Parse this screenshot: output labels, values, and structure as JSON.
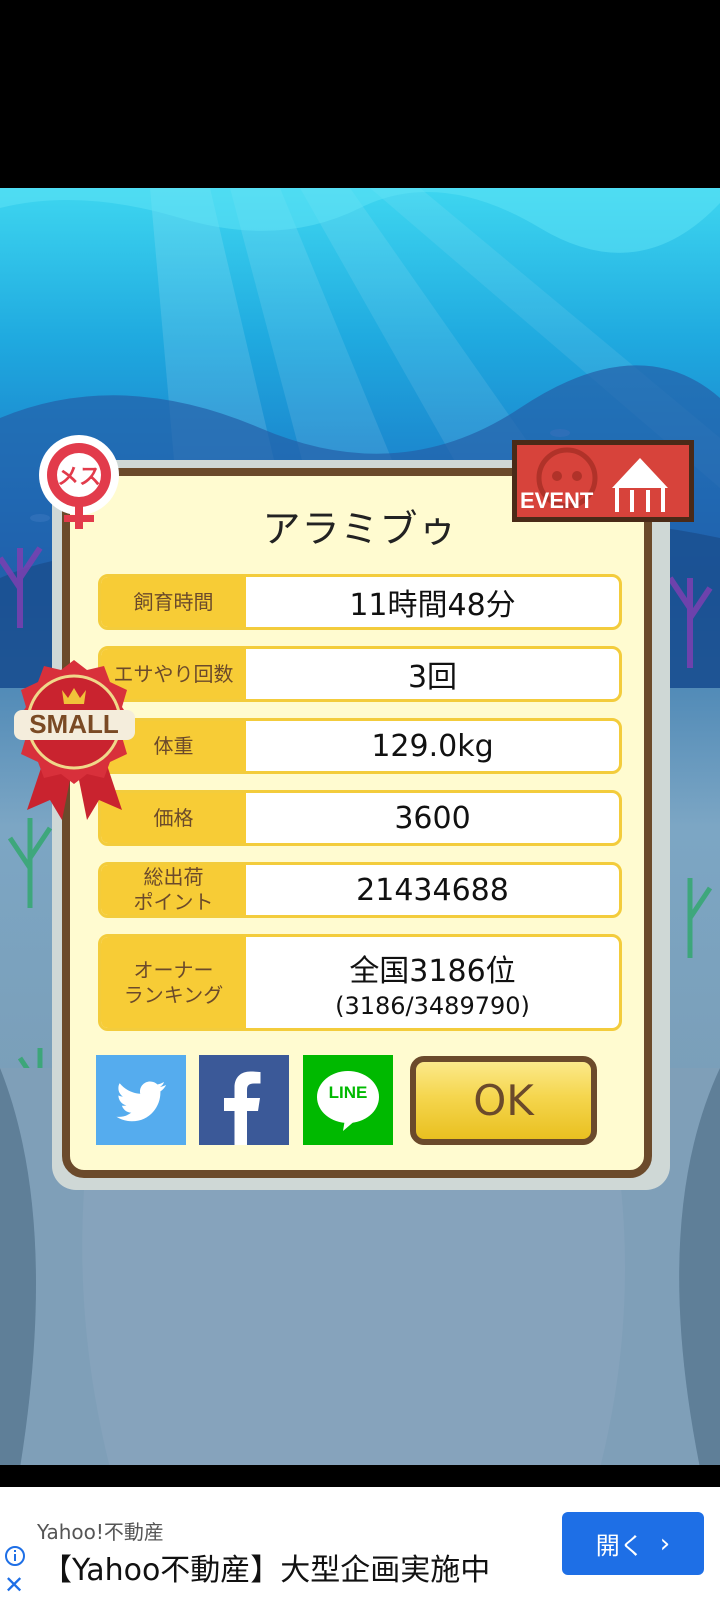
{
  "fish": {
    "name": "アラミブゥ",
    "gender_label": "メス",
    "size_badge": "SMALL",
    "event_label": "EVENT"
  },
  "stats": [
    {
      "label": "飼育時間",
      "value": "11時間48分"
    },
    {
      "label": "エサやり回数",
      "value": "3回"
    },
    {
      "label": "体重",
      "value": "129.0kg"
    },
    {
      "label": "価格",
      "value": "3600"
    },
    {
      "label": "総出荷\nポイント",
      "value": "21434688"
    },
    {
      "label": "オーナー\nランキング",
      "value": "全国3186位",
      "sub": "(3186/3489790)"
    }
  ],
  "share": {
    "twitter_icon": "twitter-bird-icon",
    "facebook_icon": "facebook-f-icon",
    "line_label": "LINE"
  },
  "ok_label": "OK",
  "ad": {
    "sponsor": "Yahoo!不動産",
    "title": "【Yahoo不動産】大型企画実施中",
    "button_label": "開く",
    "button_color": "#1e6fe6"
  },
  "colors": {
    "frame": "#6b4a2b",
    "label_bg": "#f7cc36",
    "card_bg": "#fffbd0"
  }
}
